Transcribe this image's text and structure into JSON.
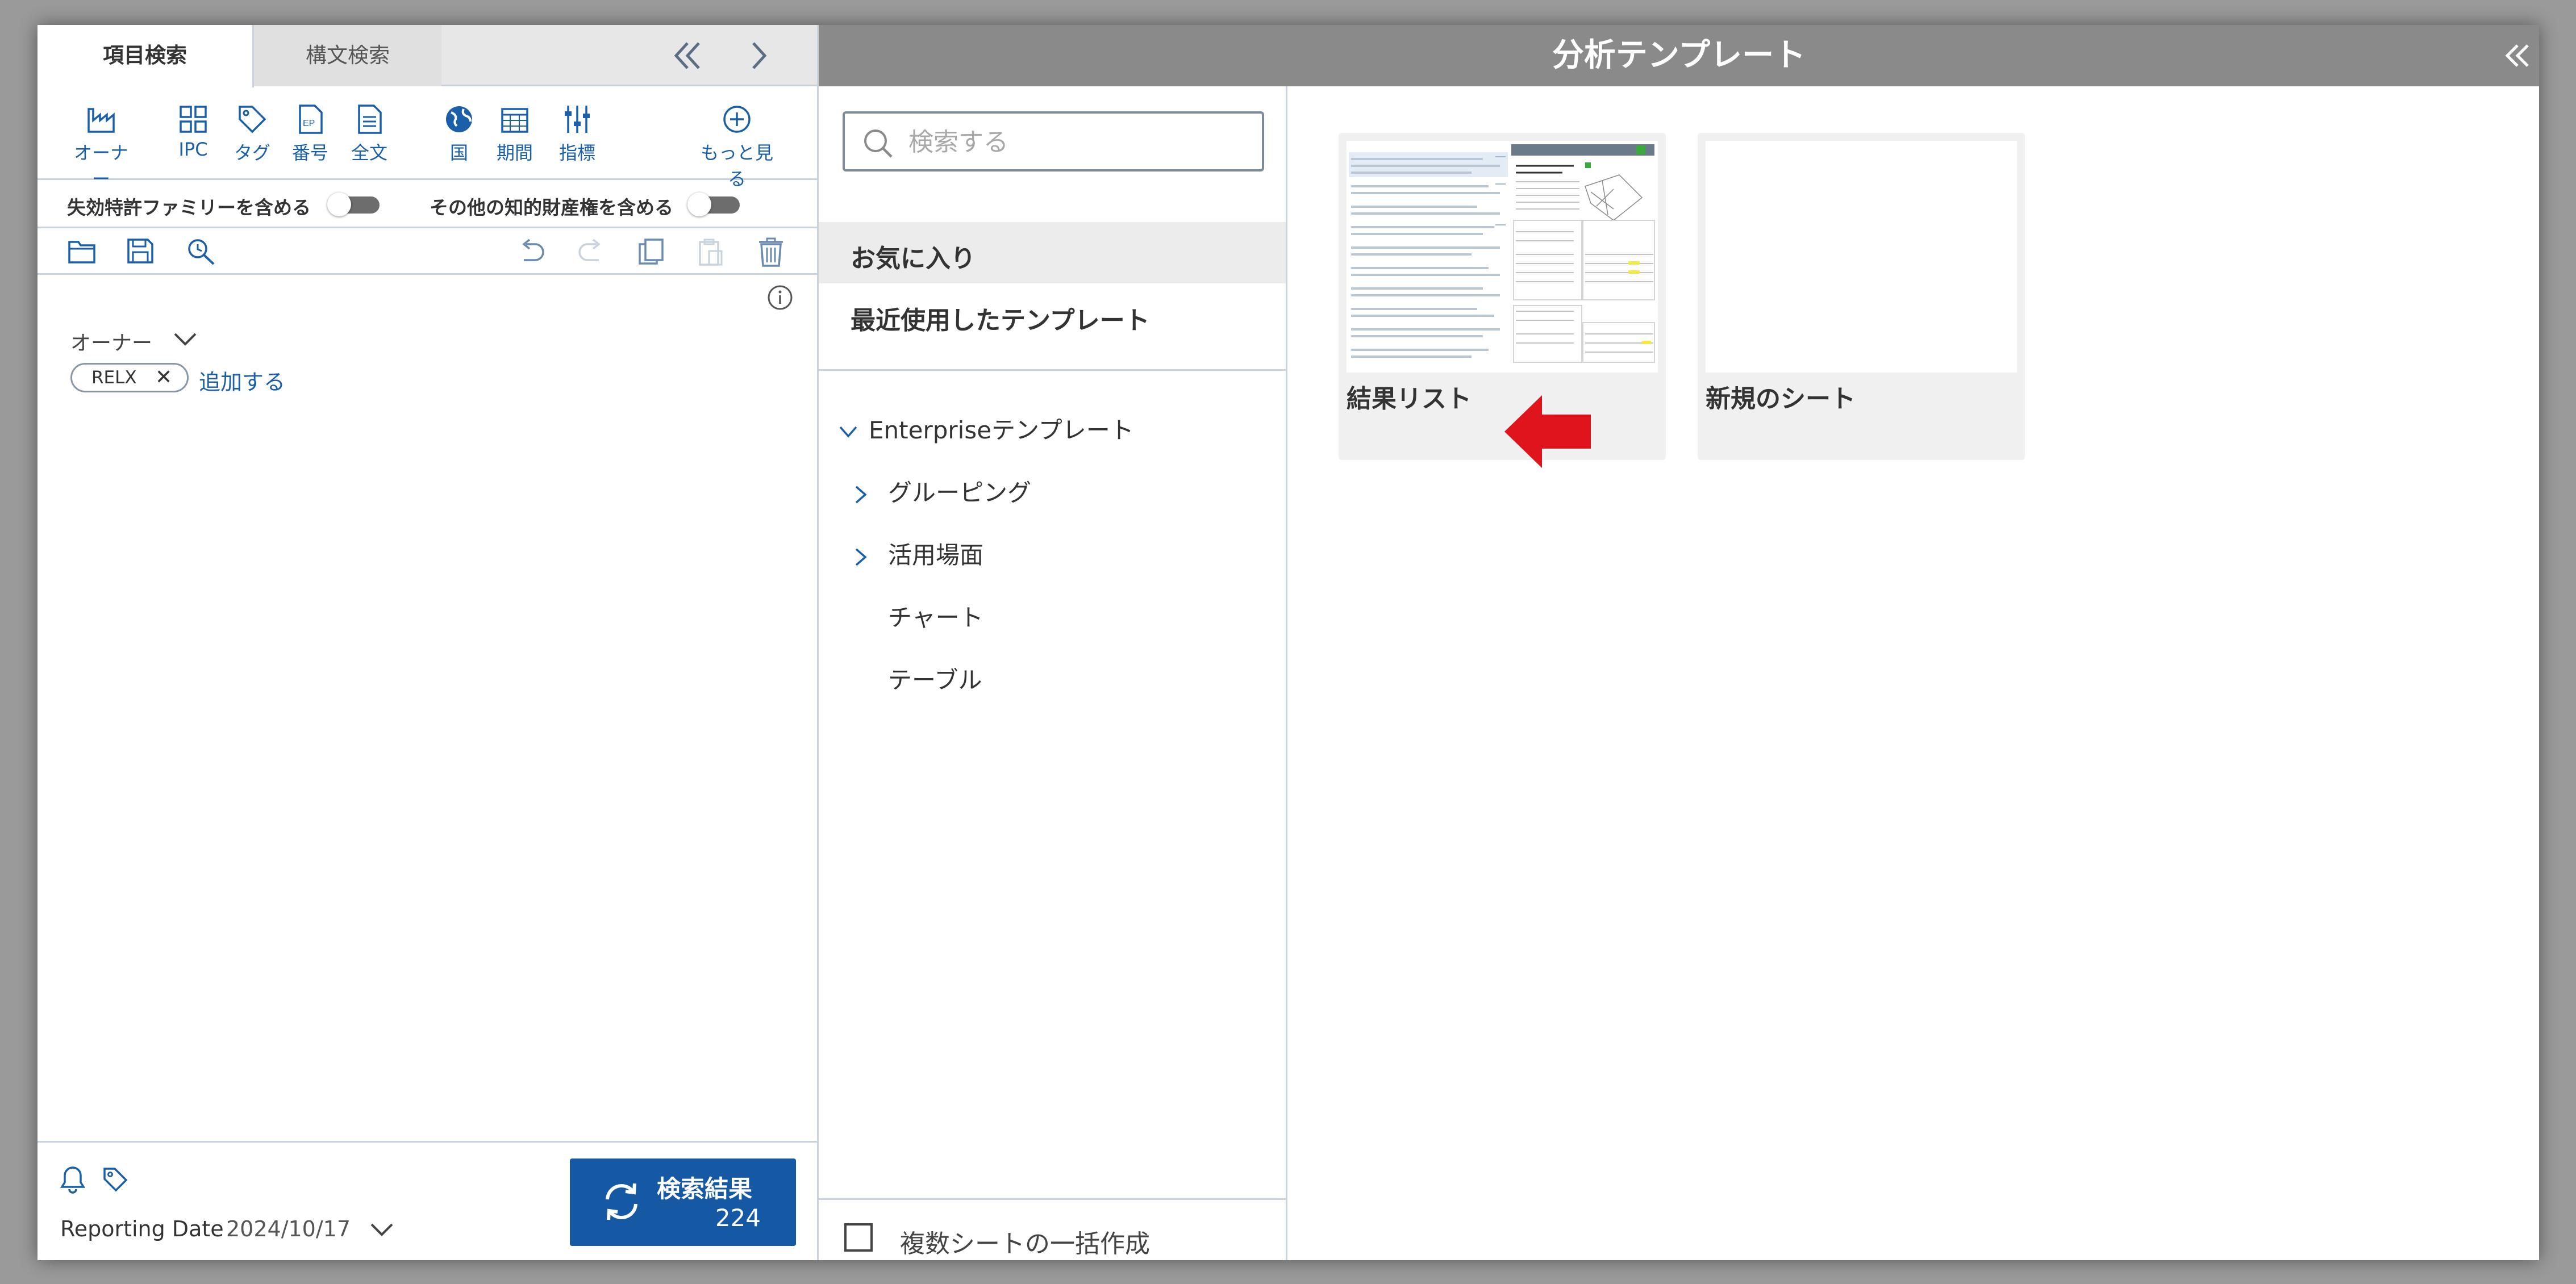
{
  "left_panel": {
    "tabs": {
      "active": "項目検索",
      "second": "構文検索"
    },
    "icons": [
      {
        "label": "オーナー",
        "icon": "factory-icon"
      },
      {
        "label": "IPC",
        "icon": "grid-icon"
      },
      {
        "label": "タグ",
        "icon": "tag-icon"
      },
      {
        "label": "番号",
        "icon": "ep-document-icon"
      },
      {
        "label": "全文",
        "icon": "document-text-icon"
      },
      {
        "label": "国",
        "icon": "globe-icon"
      },
      {
        "label": "期間",
        "icon": "calendar-icon"
      },
      {
        "label": "指標",
        "icon": "sliders-icon"
      },
      {
        "label": "もっと見る",
        "icon": "plus-circle-icon"
      }
    ],
    "toggles": {
      "expired_family": "失効特許ファミリーを含める",
      "other_ip": "その他の知的財産権を含める"
    },
    "owner": {
      "label": "オーナー",
      "chip": "RELX",
      "add_link": "追加する"
    },
    "bottom": {
      "reporting_label": "Reporting Date",
      "reporting_date": "2024/10/17",
      "search_button_title": "検索結果",
      "search_button_count": "224"
    }
  },
  "header": {
    "title": "分析テンプレート"
  },
  "middle_panel": {
    "search_placeholder": "検索する",
    "favorites": "お気に入り",
    "recent": "最近使用したテンプレート",
    "tree": {
      "root": "Enterpriseテンプレート",
      "grouping": "グルーピング",
      "use_cases": "活用場面",
      "chart": "チャート",
      "table": "テーブル"
    },
    "batch_create": "複数シートの一括作成"
  },
  "templates": [
    {
      "label": "結果リスト"
    },
    {
      "label": "新規のシート"
    }
  ],
  "colors": {
    "accent": "#1558a4",
    "header": "#8a8a8a",
    "arrow": "#e0141c"
  }
}
